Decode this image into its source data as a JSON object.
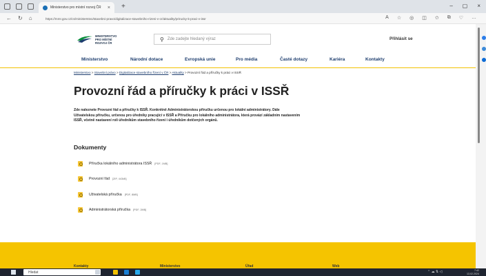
{
  "browser": {
    "tab_title": "Ministerstvo pro místní rozvoj ČR",
    "url": "https://mmr.gov.cz/cs/ministerstvo/stavebni-pravo/digitalizace-stavebniho-rizeni-v-cr/aktuality/prirucky-k-praci-v-issr"
  },
  "header": {
    "logo_text": [
      "MINISTERSTVO",
      "PRO MÍSTNÍ",
      "ROZVOJ ČR"
    ],
    "search_placeholder": "Zde zadejte hledaný výraz",
    "login_label": "Přihlásit se"
  },
  "nav": [
    "Ministerstvo",
    "Národní dotace",
    "Evropská unie",
    "Pro média",
    "Časté dotazy",
    "Kariéra",
    "Kontakty"
  ],
  "breadcrumb": {
    "items": [
      "Ministerstvo",
      "Stavební právo",
      "Digitalizace stavebního řízení v ČR",
      "Aktuality"
    ],
    "current": "Provozní řád a příručky k práci v ISSŘ"
  },
  "title": "Provozní řád a příručky k práci v ISSŘ",
  "intro": "Zde naleznete Provozní řád a příručky k ISSŘ. Konkrétně Administrátorskou příručku určenou pro lokální administrátory. Dále Uživatelskou příručku, určenou pro úředníky pracující v ISSŘ a Příručku pro lokálního administrátora, která provází základním nastavením ISSŘ, včetně nastavení rolí úředníkům stavebního řízení i úředníkům dotčených orgánů.",
  "documents_heading": "Dokumenty",
  "documents": [
    {
      "label": "Příručka lokálního administrátora ISSŘ",
      "meta": "[PDF, 1MB]"
    },
    {
      "label": "Provozní řád",
      "meta": "[ZIP, 443kB]"
    },
    {
      "label": "Uživatelská příručka",
      "meta": "[PDF, 8MB]"
    },
    {
      "label": "Administrátorská příručka",
      "meta": "[PDF, 2MB]"
    }
  ],
  "footer": [
    "Kontakty",
    "Ministerstvo",
    "Úřad",
    "Web"
  ],
  "taskbar": {
    "search": "Hledat",
    "time": "7:42",
    "date": "13.02.2024"
  },
  "colors": {
    "accent": "#f5c400",
    "nav_text": "#1d3d6e"
  }
}
